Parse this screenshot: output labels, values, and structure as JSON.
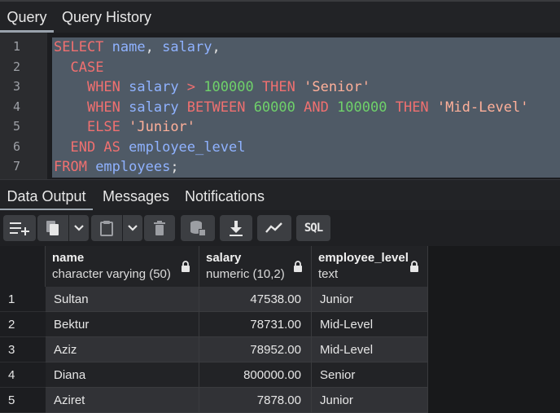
{
  "top_tabs": {
    "query": "Query",
    "history": "Query History"
  },
  "editor": {
    "line_numbers": [
      "1",
      "2",
      "3",
      "4",
      "5",
      "6",
      "7"
    ],
    "lines": [
      [
        {
          "t": "kw",
          "v": "SELECT "
        },
        {
          "t": "id",
          "v": "name"
        },
        {
          "t": "pl",
          "v": ", "
        },
        {
          "t": "id",
          "v": "salary"
        },
        {
          "t": "pl",
          "v": ","
        }
      ],
      [
        {
          "t": "pl",
          "v": "  "
        },
        {
          "t": "kw",
          "v": "CASE"
        }
      ],
      [
        {
          "t": "pl",
          "v": "    "
        },
        {
          "t": "kw",
          "v": "WHEN "
        },
        {
          "t": "id",
          "v": "salary "
        },
        {
          "t": "op",
          "v": "> "
        },
        {
          "t": "num",
          "v": "100000 "
        },
        {
          "t": "kw",
          "v": "THEN "
        },
        {
          "t": "str",
          "v": "'Senior'"
        }
      ],
      [
        {
          "t": "pl",
          "v": "    "
        },
        {
          "t": "kw",
          "v": "WHEN "
        },
        {
          "t": "id",
          "v": "salary "
        },
        {
          "t": "kw",
          "v": "BETWEEN "
        },
        {
          "t": "num",
          "v": "60000 "
        },
        {
          "t": "kw",
          "v": "AND "
        },
        {
          "t": "num",
          "v": "100000 "
        },
        {
          "t": "kw",
          "v": "THEN "
        },
        {
          "t": "str",
          "v": "'Mid-Level'"
        }
      ],
      [
        {
          "t": "pl",
          "v": "    "
        },
        {
          "t": "kw",
          "v": "ELSE "
        },
        {
          "t": "str",
          "v": "'Junior'"
        }
      ],
      [
        {
          "t": "pl",
          "v": "  "
        },
        {
          "t": "kw",
          "v": "END AS "
        },
        {
          "t": "id",
          "v": "employee_level"
        }
      ],
      [
        {
          "t": "kw",
          "v": "FROM "
        },
        {
          "t": "id",
          "v": "employees"
        },
        {
          "t": "pl",
          "v": ";"
        }
      ]
    ]
  },
  "result_tabs": {
    "data_output": "Data Output",
    "messages": "Messages",
    "notifications": "Notifications"
  },
  "toolbar": {
    "buttons": [
      "add-row-icon",
      "copy-icon",
      "chevron-down-icon",
      "paste-icon",
      "chevron-down-icon",
      "delete-icon",
      "save-data-icon",
      "download-icon",
      "graph-icon",
      "sql-icon"
    ],
    "sql_label": "SQL"
  },
  "table": {
    "columns": [
      {
        "name": "name",
        "type": "character varying (50)"
      },
      {
        "name": "salary",
        "type": "numeric (10,2)"
      },
      {
        "name": "employee_level",
        "type": "text"
      }
    ],
    "rows": [
      {
        "num": "1",
        "name": "Sultan",
        "salary": "47538.00",
        "level": "Junior"
      },
      {
        "num": "2",
        "name": "Bektur",
        "salary": "78731.00",
        "level": "Mid-Level"
      },
      {
        "num": "3",
        "name": "Aziz",
        "salary": "78952.00",
        "level": "Mid-Level"
      },
      {
        "num": "4",
        "name": "Diana",
        "salary": "800000.00",
        "level": "Senior"
      },
      {
        "num": "5",
        "name": "Aziret",
        "salary": "7878.00",
        "level": "Junior"
      }
    ]
  },
  "colors": {
    "keyword": "#f07070",
    "identifier": "#8fb2ff",
    "number": "#6fd16a",
    "string": "#ffb09a",
    "selection": "#4f5a66"
  }
}
